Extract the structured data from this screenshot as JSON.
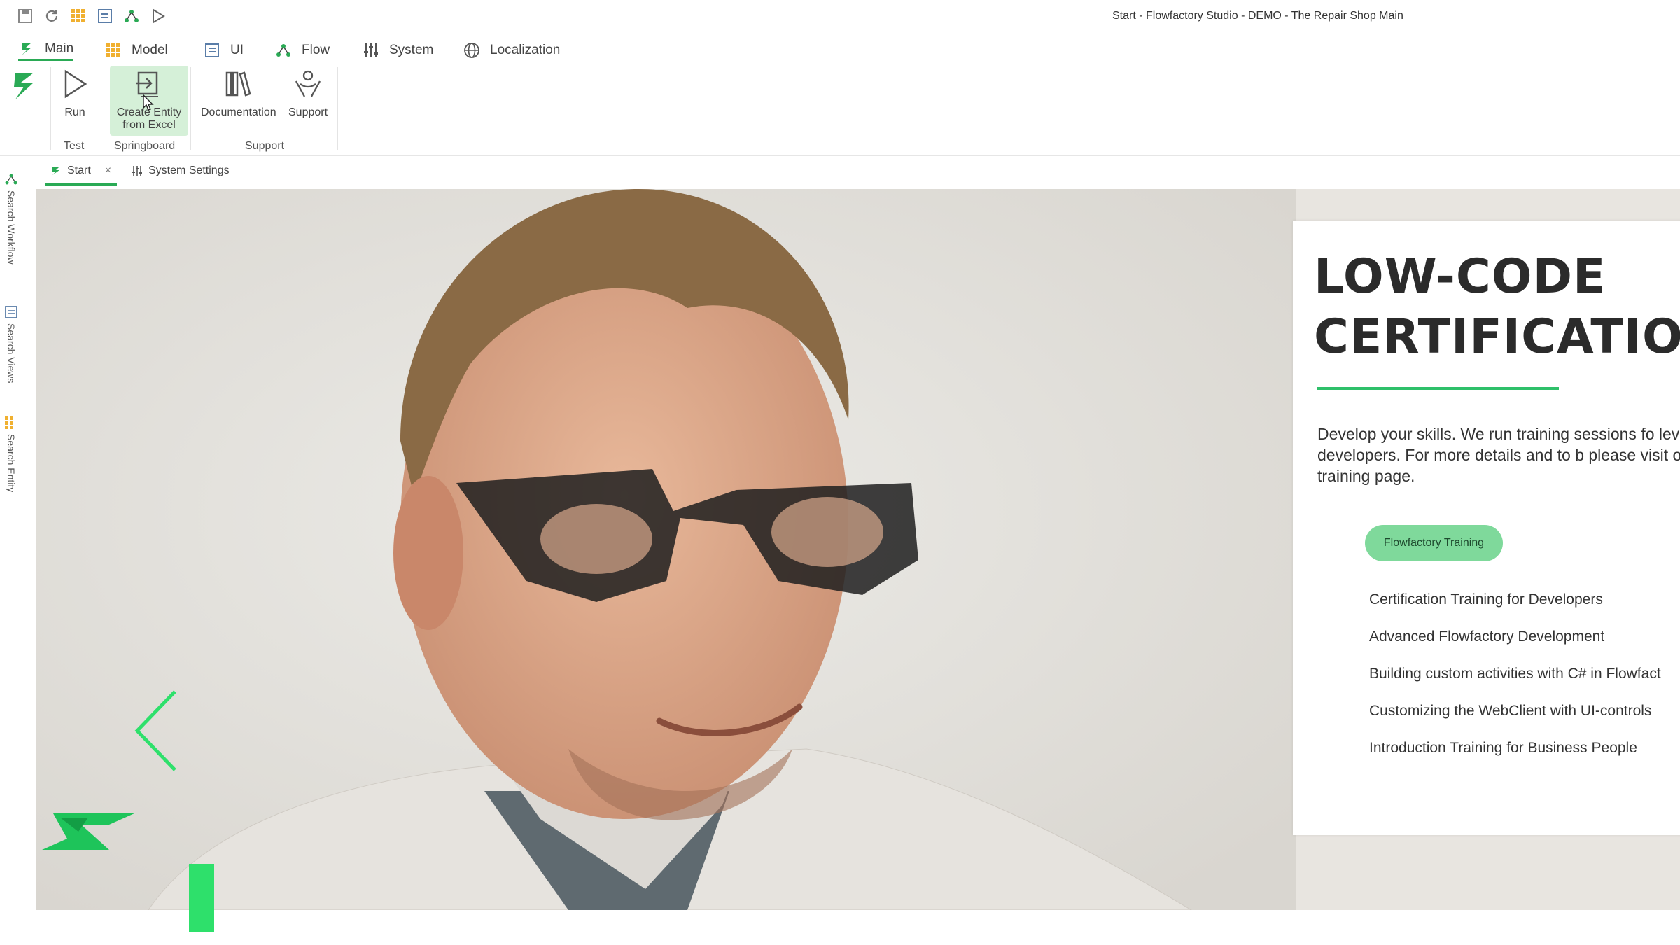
{
  "window": {
    "title": "Start - Flowfactory Studio - DEMO - The Repair Shop Main"
  },
  "menu": {
    "tabs": [
      {
        "label": "Main",
        "icon": "flowfactory-logo-icon"
      },
      {
        "label": "Model",
        "icon": "grid-icon"
      },
      {
        "label": "UI",
        "icon": "form-icon"
      },
      {
        "label": "Flow",
        "icon": "flow-icon"
      },
      {
        "label": "System",
        "icon": "sliders-icon"
      },
      {
        "label": "Localization",
        "icon": "globe-icon"
      }
    ]
  },
  "ribbon": {
    "run": "Run",
    "create_entity": "Create Entity from Excel",
    "documentation": "Documentation",
    "support": "Support",
    "groups": {
      "test": "Test",
      "springboard": "Springboard",
      "support": "Support"
    }
  },
  "doc_tabs": [
    {
      "label": "Start",
      "close": "×"
    },
    {
      "label": "System Settings"
    }
  ],
  "left_tools": [
    "Search Workflow",
    "Search Views",
    "Search Entity"
  ],
  "page": {
    "heading": "LOW-CODE\nCERTIFICATION",
    "intro": "Develop your skills. We run training sessions fo levels of developers. For more details and to b please visit our training page.",
    "button": "Flowfactory Training",
    "trainings": [
      "Certification Training for Developers",
      "Advanced Flowfactory Development",
      "Building custom activities with C# in Flowfact",
      "Customizing the WebClient with UI-controls",
      "Introduction Training for Business People"
    ]
  },
  "colors": {
    "accent": "#2aaa55",
    "button": "#7fd99b",
    "highlight": "#d5f0d8"
  }
}
